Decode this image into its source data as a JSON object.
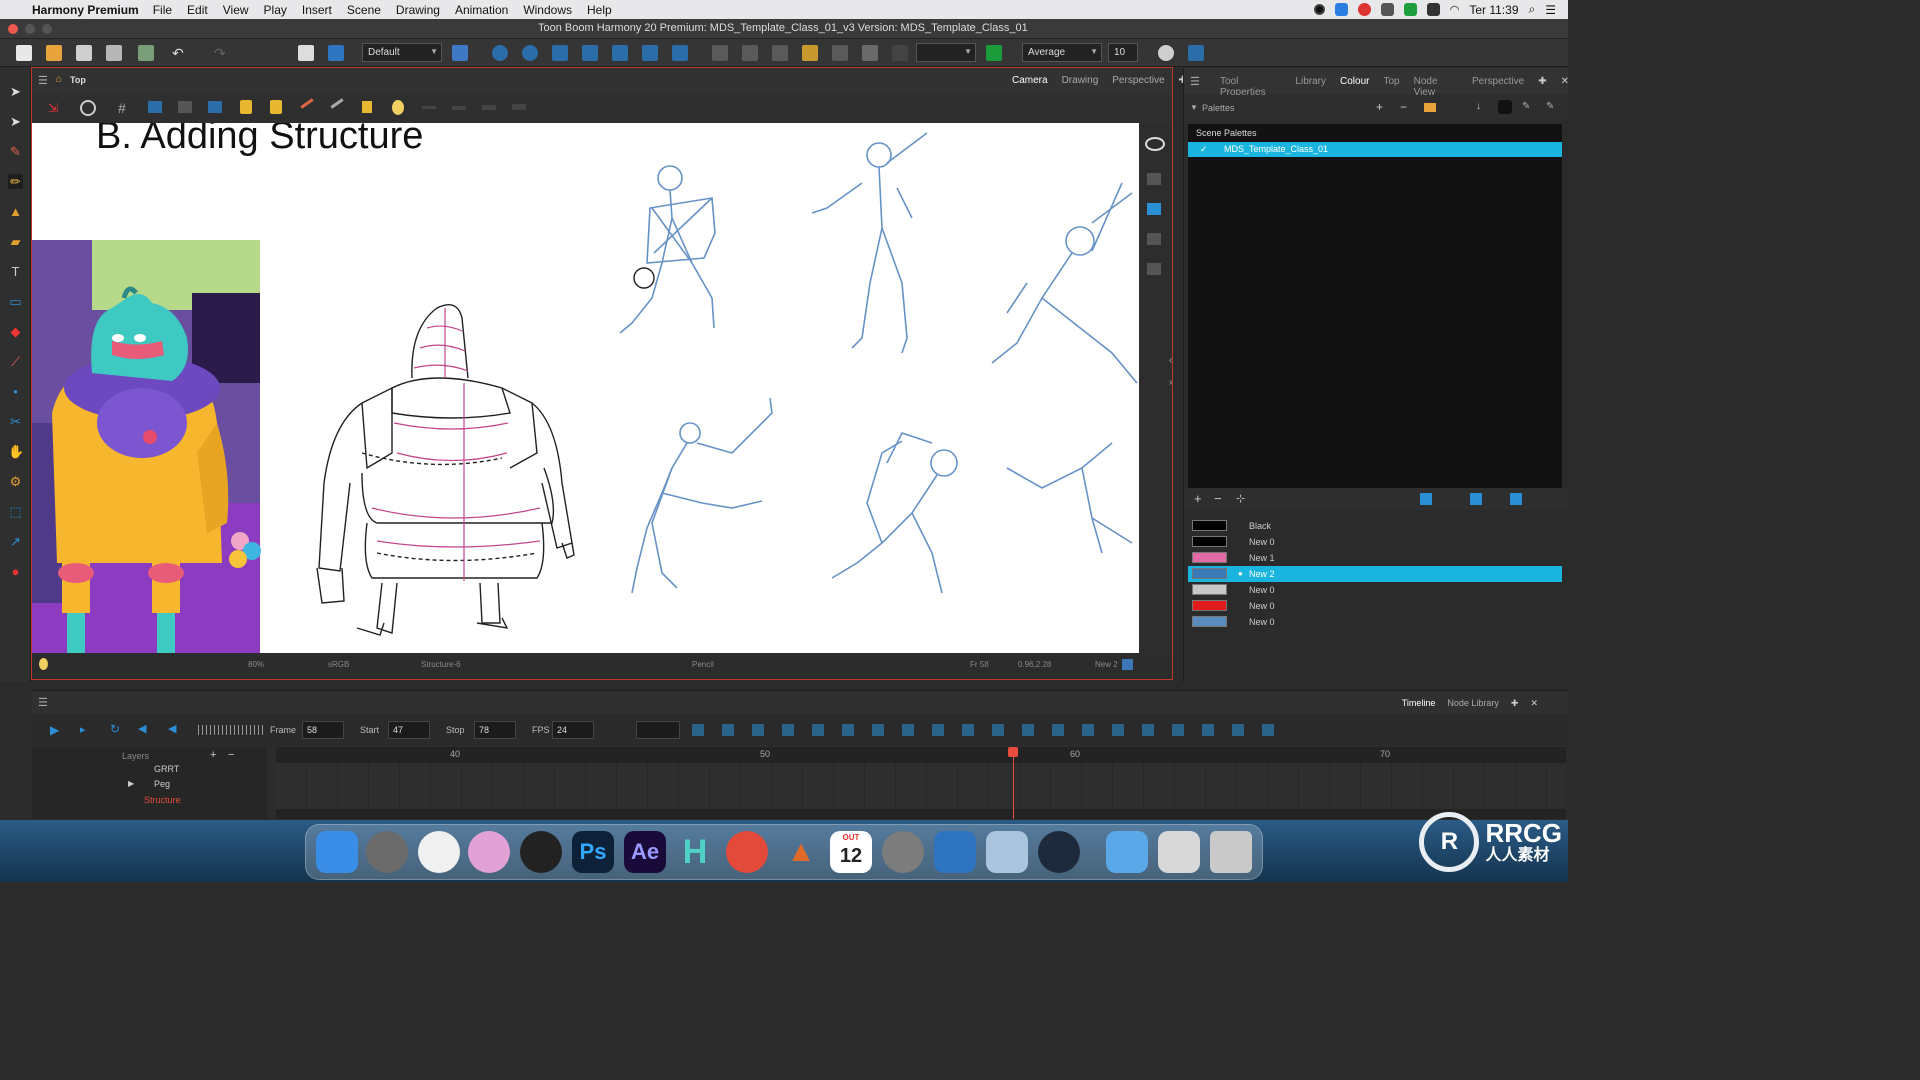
{
  "menubar": {
    "app_name": "Harmony Premium",
    "items": [
      "File",
      "Edit",
      "View",
      "Play",
      "Insert",
      "Scene",
      "Drawing",
      "Animation",
      "Windows",
      "Help"
    ],
    "clock": "Ter 11:39"
  },
  "window": {
    "title": "Toon Boom Harmony 20 Premium: MDS_Template_Class_01_v3 Version: MDS_Template_Class_01"
  },
  "toolbar": {
    "workspace_select": "Default",
    "smoothing_select": "Average",
    "size_value": "10"
  },
  "view": {
    "breadcrumb": "Top",
    "tabs": [
      "Camera",
      "Drawing",
      "Perspective"
    ],
    "active_tab": "Camera",
    "canvas_title": "B. Adding Structure",
    "status": {
      "zoom": "80%",
      "color_space": "sRGB",
      "drawing_name": "Structure-6",
      "tool": "Pencil",
      "frame": "Fr 58",
      "coords": "0.96,2.28",
      "swatch": "New 2"
    }
  },
  "right_panel": {
    "tabs": [
      "Tool Properties",
      "Library",
      "Colour",
      "Top",
      "Node View",
      "Perspective"
    ],
    "active_tab": "Colour",
    "palettes_label": "Palettes",
    "scene_palettes_label": "Scene Palettes",
    "palette_item": "MDS_Template_Class_01",
    "swatches": [
      {
        "name": "Black",
        "color": "#000000"
      },
      {
        "name": "New 0",
        "color": "#000000"
      },
      {
        "name": "New 1",
        "color": "#e06aa6"
      },
      {
        "name": "New 2",
        "color": "#3a78b8"
      },
      {
        "name": "New 0",
        "color": "#c8c8c8"
      },
      {
        "name": "New 0",
        "color": "#e01b1b"
      },
      {
        "name": "New 0",
        "color": "#5b8cc0"
      }
    ],
    "selected_swatch_index": 3
  },
  "timeline": {
    "tabs": [
      "Timeline",
      "Node Library"
    ],
    "active_tab": "Timeline",
    "frame_label": "Frame",
    "frame_value": "58",
    "start_label": "Start",
    "start_value": "47",
    "stop_label": "Stop",
    "stop_value": "78",
    "fps_label": "FPS",
    "fps_value": "24",
    "layers_label": "Layers",
    "layers": [
      "GRRT",
      "Peg",
      "Structure"
    ],
    "ruler": [
      "40",
      "50",
      "60",
      "70"
    ]
  },
  "dock": {
    "calendar_month": "OUT",
    "calendar_day": "12"
  },
  "brand": {
    "name": "RRCG",
    "subtitle": "人人素材"
  }
}
